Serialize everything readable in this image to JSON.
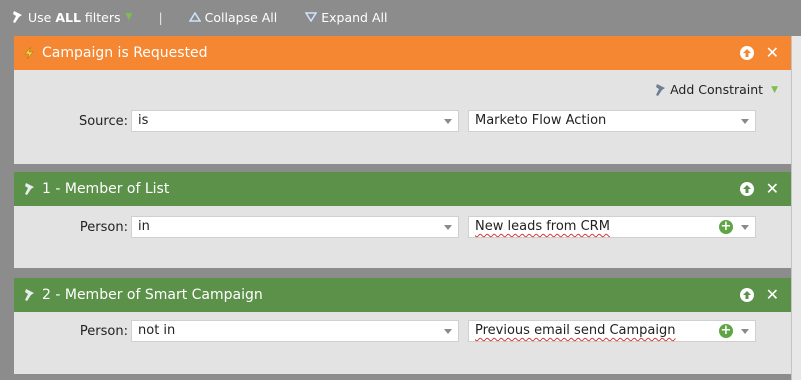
{
  "toolbar": {
    "use_filters_prefix": "Use ",
    "use_filters_bold": "ALL",
    "use_filters_suffix": " filters",
    "separator": "|",
    "collapse_label": "Collapse All",
    "expand_label": "Expand All"
  },
  "trigger": {
    "title": "Campaign is Requested",
    "add_constraint_label": "Add Constraint",
    "row": {
      "label": "Source:",
      "operator": "is",
      "value": "Marketo Flow Action"
    }
  },
  "filters": [
    {
      "title": "1 - Member of List",
      "row": {
        "label": "Person:",
        "operator": "in",
        "value": "New leads from CRM"
      }
    },
    {
      "title": "2 - Member of Smart Campaign",
      "row": {
        "label": "Person:",
        "operator": "not in",
        "value": "Previous email send Campaign"
      }
    }
  ],
  "colors": {
    "trigger_header": "#f58732",
    "filter_header": "#5b9149",
    "background": "#8c8c8c",
    "card_body": "#e3e3e3"
  },
  "icons": [
    "filter-icon",
    "triangle-up-icon",
    "triangle-down-icon",
    "lightning-icon",
    "arrow-up-icon",
    "close-icon",
    "plus-icon",
    "chevron-down-icon"
  ]
}
